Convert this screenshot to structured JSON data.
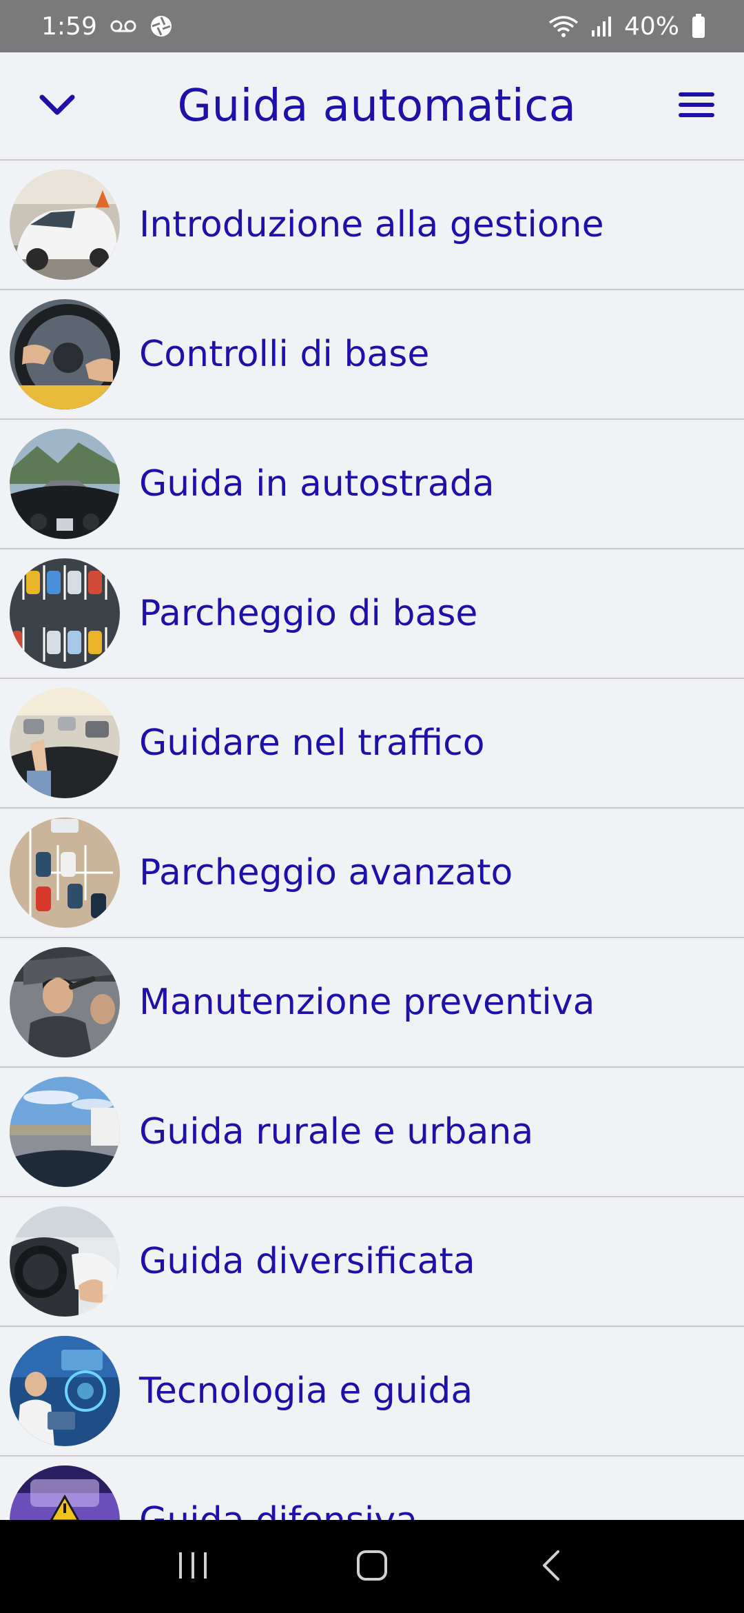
{
  "status_bar": {
    "time": "1:59",
    "battery": "40%",
    "icons": [
      "voicemail-icon",
      "camera-shutter-icon",
      "wifi-icon",
      "signal-icon",
      "battery-icon"
    ]
  },
  "header": {
    "title": "Guida automatica",
    "left_icon": "chevron-down-icon",
    "right_icon": "menu-icon",
    "accent_color": "#1e10a8"
  },
  "lessons": [
    {
      "label": "Introduzione alla gestione",
      "thumb": "car-thumbnail"
    },
    {
      "label": "Controlli di base",
      "thumb": "steering-wheel-thumbnail"
    },
    {
      "label": "Guida in autostrada",
      "thumb": "highway-thumbnail"
    },
    {
      "label": "Parcheggio di base",
      "thumb": "parking-lot-thumbnail"
    },
    {
      "label": "Guidare nel traffico",
      "thumb": "traffic-thumbnail"
    },
    {
      "label": "Parcheggio avanzato",
      "thumb": "parking-aerial-thumbnail"
    },
    {
      "label": "Manutenzione preventiva",
      "thumb": "maintenance-thumbnail"
    },
    {
      "label": "Guida rurale e urbana",
      "thumb": "rural-road-thumbnail"
    },
    {
      "label": "Guida diversificata",
      "thumb": "dashboard-thumbnail"
    },
    {
      "label": "Tecnologia e guida",
      "thumb": "tech-thumbnail"
    },
    {
      "label": "Guida difensiva",
      "thumb": "defensive-thumbnail"
    }
  ],
  "nav_bar": {
    "icons": [
      "recents-icon",
      "home-icon",
      "back-icon"
    ]
  }
}
